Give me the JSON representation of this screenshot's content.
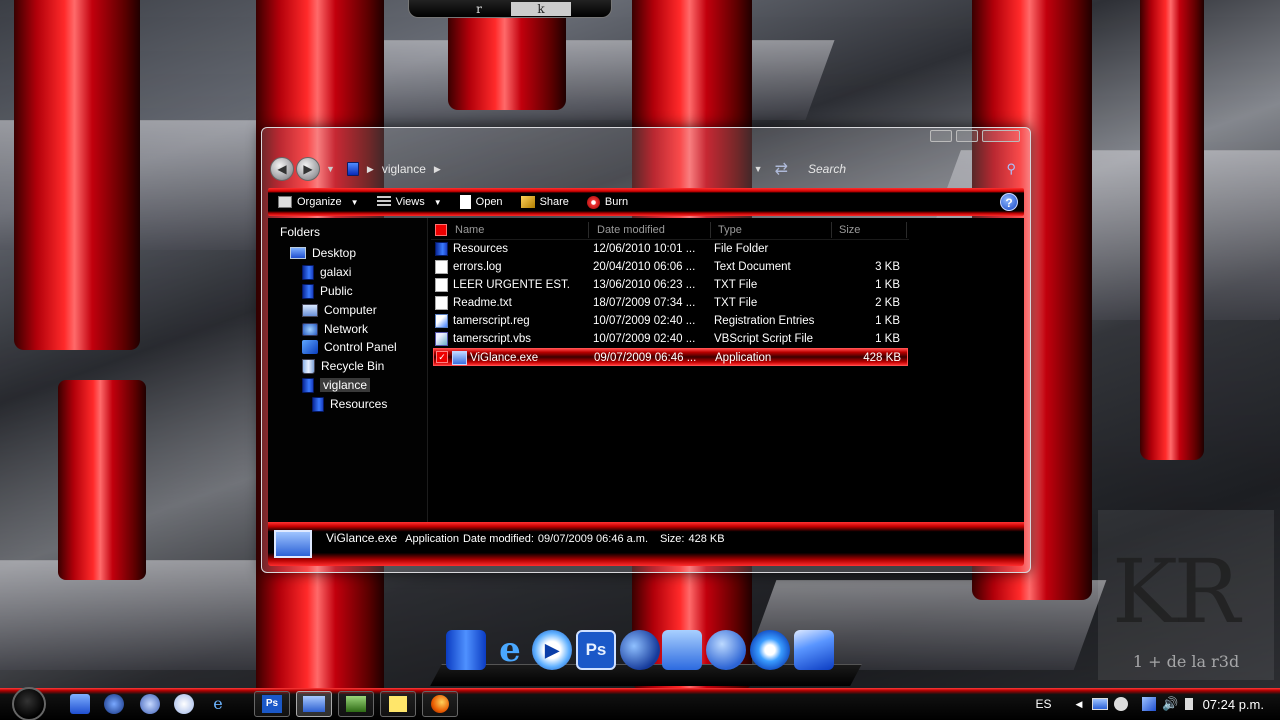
{
  "topbar": {
    "tabs": [
      "r",
      "k"
    ]
  },
  "window": {
    "address": {
      "path": [
        "viglance"
      ]
    },
    "search": {
      "placeholder": "Search"
    },
    "toolbar": {
      "organize": "Organize",
      "views": "Views",
      "open": "Open",
      "share": "Share",
      "burn": "Burn"
    },
    "folders": {
      "title": "Folders",
      "items": [
        {
          "label": "Desktop",
          "icon": "desktop-icon"
        },
        {
          "label": "galaxi",
          "icon": "folder-icon"
        },
        {
          "label": "Public",
          "icon": "folder-icon"
        },
        {
          "label": "Computer",
          "icon": "computer-icon"
        },
        {
          "label": "Network",
          "icon": "network-icon"
        },
        {
          "label": "Control Panel",
          "icon": "control-panel-icon"
        },
        {
          "label": "Recycle Bin",
          "icon": "recycle-bin-icon"
        },
        {
          "label": "viglance",
          "icon": "folder-icon",
          "selected": true
        },
        {
          "label": "Resources",
          "icon": "folder-icon"
        }
      ]
    },
    "columns": [
      "Name",
      "Date modified",
      "Type",
      "Size"
    ],
    "files": [
      {
        "name": "Resources",
        "date": "12/06/2010 10:01 ...",
        "type": "File Folder",
        "size": "",
        "icon": "folder-icon"
      },
      {
        "name": "errors.log",
        "date": "20/04/2010 06:06 ...",
        "type": "Text Document",
        "size": "3 KB",
        "icon": "text-file-icon"
      },
      {
        "name": "LEER URGENTE EST...",
        "date": "13/06/2010 06:23 ...",
        "type": "TXT File",
        "size": "1 KB",
        "icon": "text-file-icon"
      },
      {
        "name": "Readme.txt",
        "date": "18/07/2009 07:34 ...",
        "type": "TXT File",
        "size": "2 KB",
        "icon": "text-file-icon"
      },
      {
        "name": "tamerscript.reg",
        "date": "10/07/2009 02:40 ...",
        "type": "Registration Entries",
        "size": "1 KB",
        "icon": "registry-file-icon"
      },
      {
        "name": "tamerscript.vbs",
        "date": "10/07/2009 02:40 ...",
        "type": "VBScript Script File",
        "size": "1 KB",
        "icon": "vbscript-file-icon"
      },
      {
        "name": "ViGlance.exe",
        "date": "09/07/2009 06:46 ...",
        "type": "Application",
        "size": "428 KB",
        "icon": "application-icon",
        "selected": true
      }
    ],
    "details": {
      "name": "ViGlance.exe",
      "type": "Application",
      "modified_label": "Date modified:",
      "modified": "09/07/2009 06:46 a.m.",
      "size_label": "Size:",
      "size": "428 KB"
    }
  },
  "dock": {
    "items": [
      "files-icon",
      "internet-explorer-icon",
      "media-player-icon",
      "Ps",
      "network-icon",
      "docs-icon",
      "messenger-icon",
      "firefox-icon",
      "mail-icon"
    ]
  },
  "watermark": {
    "big": "KR",
    "small": "1 + de la r3d"
  },
  "taskbar": {
    "lang": "ES",
    "time": "07:24 p.m."
  }
}
